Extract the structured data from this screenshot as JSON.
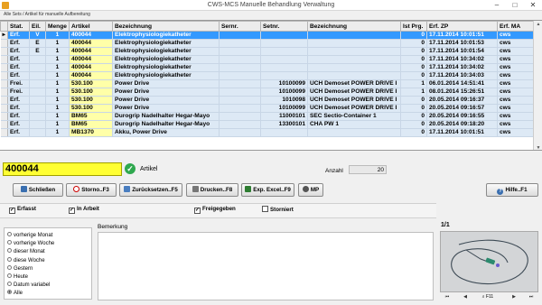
{
  "window": {
    "title": "CWS-MCS  Manuelle Behandlung Verwaltung",
    "min": "–",
    "max": "□",
    "close": "✕"
  },
  "breadcrumb": "Alle Sets / Artikel für manuelle Aufbereitung",
  "table": {
    "columns": [
      "Stat.",
      "Eil.",
      "Menge",
      "Artikel",
      "Bezeichnung",
      "Sernr.",
      "Setnr.",
      "Bezeichnung",
      "Ist Prg.",
      "Erf. ZP",
      "Erf. MA"
    ],
    "rows": [
      {
        "indicator": "▸",
        "stat": "Erf.",
        "eil": "V",
        "menge": "1",
        "artikel": "400044",
        "bezeichnung": "Elektrophysiologiekatheter",
        "sernr": "",
        "setnr": "",
        "setbez": "",
        "ist_prg": "0",
        "erf_zp": "17.11.2014 10:01:51",
        "erf_ma": "cws",
        "selected": true
      },
      {
        "indicator": "",
        "stat": "Erf.",
        "eil": "E",
        "menge": "1",
        "artikel": "400044",
        "bezeichnung": "Elektrophysiologiekatheter",
        "sernr": "",
        "setnr": "",
        "setbez": "",
        "ist_prg": "0",
        "erf_zp": "17.11.2014 10:01:53",
        "erf_ma": "cws",
        "selected": false
      },
      {
        "indicator": "",
        "stat": "Erf.",
        "eil": "E",
        "menge": "1",
        "artikel": "400044",
        "bezeichnung": "Elektrophysiologiekatheter",
        "sernr": "",
        "setnr": "",
        "setbez": "",
        "ist_prg": "0",
        "erf_zp": "17.11.2014 10:01:54",
        "erf_ma": "cws",
        "selected": false
      },
      {
        "indicator": "",
        "stat": "Erf.",
        "eil": "",
        "menge": "1",
        "artikel": "400044",
        "bezeichnung": "Elektrophysiologiekatheter",
        "sernr": "",
        "setnr": "",
        "setbez": "",
        "ist_prg": "0",
        "erf_zp": "17.11.2014 10:34:02",
        "erf_ma": "cws",
        "selected": false
      },
      {
        "indicator": "",
        "stat": "Erf.",
        "eil": "",
        "menge": "1",
        "artikel": "400044",
        "bezeichnung": "Elektrophysiologiekatheter",
        "sernr": "",
        "setnr": "",
        "setbez": "",
        "ist_prg": "0",
        "erf_zp": "17.11.2014 10:34:02",
        "erf_ma": "cws",
        "selected": false
      },
      {
        "indicator": "",
        "stat": "Erf.",
        "eil": "",
        "menge": "1",
        "artikel": "400044",
        "bezeichnung": "Elektrophysiologiekatheter",
        "sernr": "",
        "setnr": "",
        "setbez": "",
        "ist_prg": "0",
        "erf_zp": "17.11.2014 10:34:03",
        "erf_ma": "cws",
        "selected": false
      },
      {
        "indicator": "",
        "stat": "Frei.",
        "eil": "",
        "menge": "1",
        "artikel": "530.100",
        "bezeichnung": "Power Drive",
        "sernr": "",
        "setnr": "10100099",
        "setbez": "UCH Demoset POWER DRIVE I",
        "ist_prg": "1",
        "erf_zp": "06.01.2014 14:51:41",
        "erf_ma": "cws",
        "selected": false
      },
      {
        "indicator": "",
        "stat": "Frei.",
        "eil": "",
        "menge": "1",
        "artikel": "530.100",
        "bezeichnung": "Power Drive",
        "sernr": "",
        "setnr": "10100099",
        "setbez": "UCH Demoset POWER DRIVE I",
        "ist_prg": "1",
        "erf_zp": "08.01.2014 15:26:51",
        "erf_ma": "cws",
        "selected": false
      },
      {
        "indicator": "",
        "stat": "Erf.",
        "eil": "",
        "menge": "1",
        "artikel": "530.100",
        "bezeichnung": "Power Drive",
        "sernr": "",
        "setnr": "1010098",
        "setbez": "UCH Demoset POWER DRIVE I",
        "ist_prg": "0",
        "erf_zp": "20.05.2014 09:16:37",
        "erf_ma": "cws",
        "selected": false
      },
      {
        "indicator": "",
        "stat": "Erf.",
        "eil": "",
        "menge": "1",
        "artikel": "530.100",
        "bezeichnung": "Power Drive",
        "sernr": "",
        "setnr": "10100099",
        "setbez": "UCH Demoset POWER DRIVE I",
        "ist_prg": "0",
        "erf_zp": "20.05.2014 09:16:57",
        "erf_ma": "cws",
        "selected": false
      },
      {
        "indicator": "",
        "stat": "Erf.",
        "eil": "",
        "menge": "1",
        "artikel": "BM65",
        "bezeichnung": "Durogrip Nadelhalter Hegar-Mayo",
        "sernr": "",
        "setnr": "11000101",
        "setbez": "SEC Sectio-Container  1",
        "ist_prg": "0",
        "erf_zp": "20.05.2014 09:16:55",
        "erf_ma": "cws",
        "selected": false
      },
      {
        "indicator": "",
        "stat": "Erf.",
        "eil": "",
        "menge": "1",
        "artikel": "BM65",
        "bezeichnung": "Durogrip Nadelhalter Hegar-Mayo",
        "sernr": "",
        "setnr": "13300101",
        "setbez": "CHA PW  1",
        "ist_prg": "0",
        "erf_zp": "20.05.2014 09:18:20",
        "erf_ma": "cws",
        "selected": false
      },
      {
        "indicator": "",
        "stat": "Erf.",
        "eil": "",
        "menge": "1",
        "artikel": "MB1370",
        "bezeichnung": "Akku, Power Drive",
        "sernr": "",
        "setnr": "",
        "setbez": "",
        "ist_prg": "0",
        "erf_zp": "17.11.2014 10:01:51",
        "erf_ma": "cws",
        "selected": false
      }
    ]
  },
  "article_input": {
    "value": "400044",
    "label": "Artikel"
  },
  "anzahl": {
    "label": "Anzahl",
    "value": "20"
  },
  "buttons": {
    "schliessen": "Schließen",
    "storno": "Storno..F3",
    "zuruecksetzen": "Zurücksetzen..F5",
    "drucken": "Drucken..F8",
    "excel": "Exp. Excel..F9",
    "mp": "MP",
    "hilfe": "Hilfe..F1"
  },
  "filters": {
    "erfasst": {
      "label": "Erfasst",
      "checked": true
    },
    "in_arbeit": {
      "label": "In Arbeit",
      "checked": true
    },
    "freigegeben": {
      "label": "Freigegeben",
      "checked": true
    },
    "storniert": {
      "label": "Storniert",
      "checked": false
    }
  },
  "periods": [
    {
      "label": "vorherige Monat",
      "selected": false
    },
    {
      "label": "vorherige Woche",
      "selected": false
    },
    {
      "label": "dieser Monat",
      "selected": false
    },
    {
      "label": "diese Woche",
      "selected": false
    },
    {
      "label": "Gestern",
      "selected": false
    },
    {
      "label": "Heute",
      "selected": false
    },
    {
      "label": "Datum variabel",
      "selected": false
    },
    {
      "label": "Alle",
      "selected": true
    }
  ],
  "bemerkung": {
    "label": "Bemerkung",
    "value": ""
  },
  "image_viewer": {
    "page": "1/1",
    "nav": {
      "first": "⏮",
      "prev": "◀",
      "f11": "F11",
      "next": "▶",
      "last": "⏭"
    }
  },
  "colors": {
    "selected_row": "#3399ff",
    "article_input_bg": "#ffff33",
    "article_col_bg": "#ffffa8",
    "row_bg": "#dde9f5"
  }
}
